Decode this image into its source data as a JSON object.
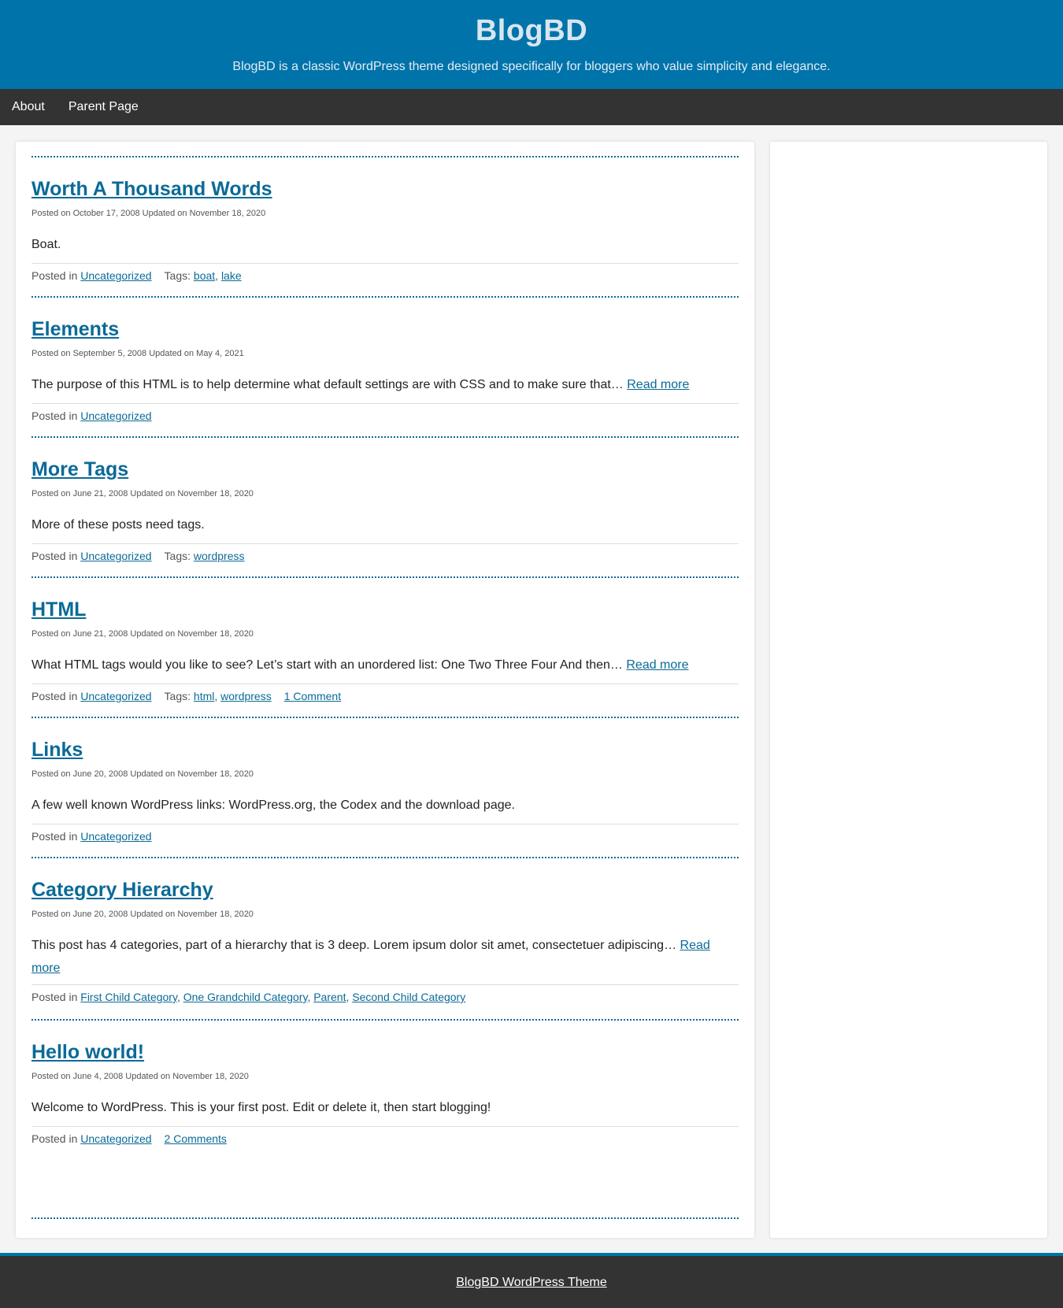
{
  "header": {
    "title": "BlogBD",
    "description": "BlogBD is a classic WordPress theme designed specifically for bloggers who value simplicity and elegance."
  },
  "nav": {
    "items": [
      {
        "label": "About"
      },
      {
        "label": "Parent Page"
      }
    ]
  },
  "posts": [
    {
      "title": "Worth A Thousand Words",
      "meta": "Posted on October 17, 2008 Updated on November 18, 2020",
      "excerpt": "Boat.",
      "read_more": "",
      "posted_in_label": "Posted in",
      "categories": [
        "Uncategorized"
      ],
      "tags_label": "Tags:",
      "tags": [
        "boat",
        "lake"
      ],
      "comments": ""
    },
    {
      "title": "Elements",
      "meta": "Posted on September 5, 2008 Updated on May 4, 2021",
      "excerpt": "The purpose of this HTML is to help determine what default settings are with CSS and to make sure that…",
      "read_more": "Read more",
      "posted_in_label": "Posted in",
      "categories": [
        "Uncategorized"
      ],
      "tags_label": "",
      "tags": [],
      "comments": ""
    },
    {
      "title": "More Tags",
      "meta": "Posted on June 21, 2008 Updated on November 18, 2020",
      "excerpt": "More of these posts need tags.",
      "read_more": "",
      "posted_in_label": "Posted in",
      "categories": [
        "Uncategorized"
      ],
      "tags_label": "Tags:",
      "tags": [
        "wordpress"
      ],
      "comments": ""
    },
    {
      "title": "HTML",
      "meta": "Posted on June 21, 2008 Updated on November 18, 2020",
      "excerpt": "What HTML tags would you like to see? Let’s start with an unordered list: One Two Three Four And then…",
      "read_more": "Read more",
      "posted_in_label": "Posted in",
      "categories": [
        "Uncategorized"
      ],
      "tags_label": "Tags:",
      "tags": [
        "html",
        "wordpress"
      ],
      "comments": "1 Comment"
    },
    {
      "title": "Links",
      "meta": "Posted on June 20, 2008 Updated on November 18, 2020",
      "excerpt": "A few well known WordPress links: WordPress.org, the Codex and the download page.",
      "read_more": "",
      "posted_in_label": "Posted in",
      "categories": [
        "Uncategorized"
      ],
      "tags_label": "",
      "tags": [],
      "comments": ""
    },
    {
      "title": "Category Hierarchy",
      "meta": "Posted on June 20, 2008 Updated on November 18, 2020",
      "excerpt": "This post has 4 categories, part of a hierarchy that is 3 deep. Lorem ipsum dolor sit amet, consectetuer adipiscing…",
      "read_more": "Read more",
      "posted_in_label": "Posted in",
      "categories": [
        "First Child Category",
        "One Grandchild Category",
        "Parent",
        "Second Child Category"
      ],
      "tags_label": "",
      "tags": [],
      "comments": ""
    },
    {
      "title": "Hello world!",
      "meta": "Posted on June 4, 2008 Updated on November 18, 2020",
      "excerpt": "Welcome to WordPress. This is your first post. Edit or delete it, then start blogging!",
      "read_more": "",
      "posted_in_label": "Posted in",
      "categories": [
        "Uncategorized"
      ],
      "tags_label": "",
      "tags": [],
      "comments": "2 Comments"
    }
  ],
  "footer": {
    "link_text": "BlogBD WordPress Theme"
  },
  "colors": {
    "header_bg": "#0073aa",
    "nav_bg": "#333333",
    "link": "#0a6a97",
    "page_bg": "#f4f4f4"
  }
}
